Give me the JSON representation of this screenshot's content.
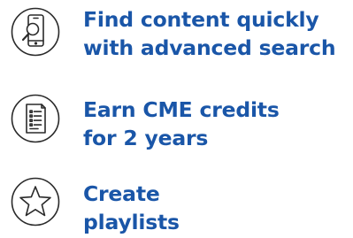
{
  "colors": {
    "text": "#1a56a8",
    "icon_stroke": "#2a2a2a",
    "background": "#ffffff"
  },
  "features": [
    {
      "icon": "mobile-search-icon",
      "lines": [
        "Find content quickly",
        "with advanced search"
      ]
    },
    {
      "icon": "document-list-icon",
      "lines": [
        "Earn CME credits",
        "for 2 years"
      ]
    },
    {
      "icon": "star-icon",
      "lines": [
        "Create",
        "playlists"
      ]
    }
  ]
}
